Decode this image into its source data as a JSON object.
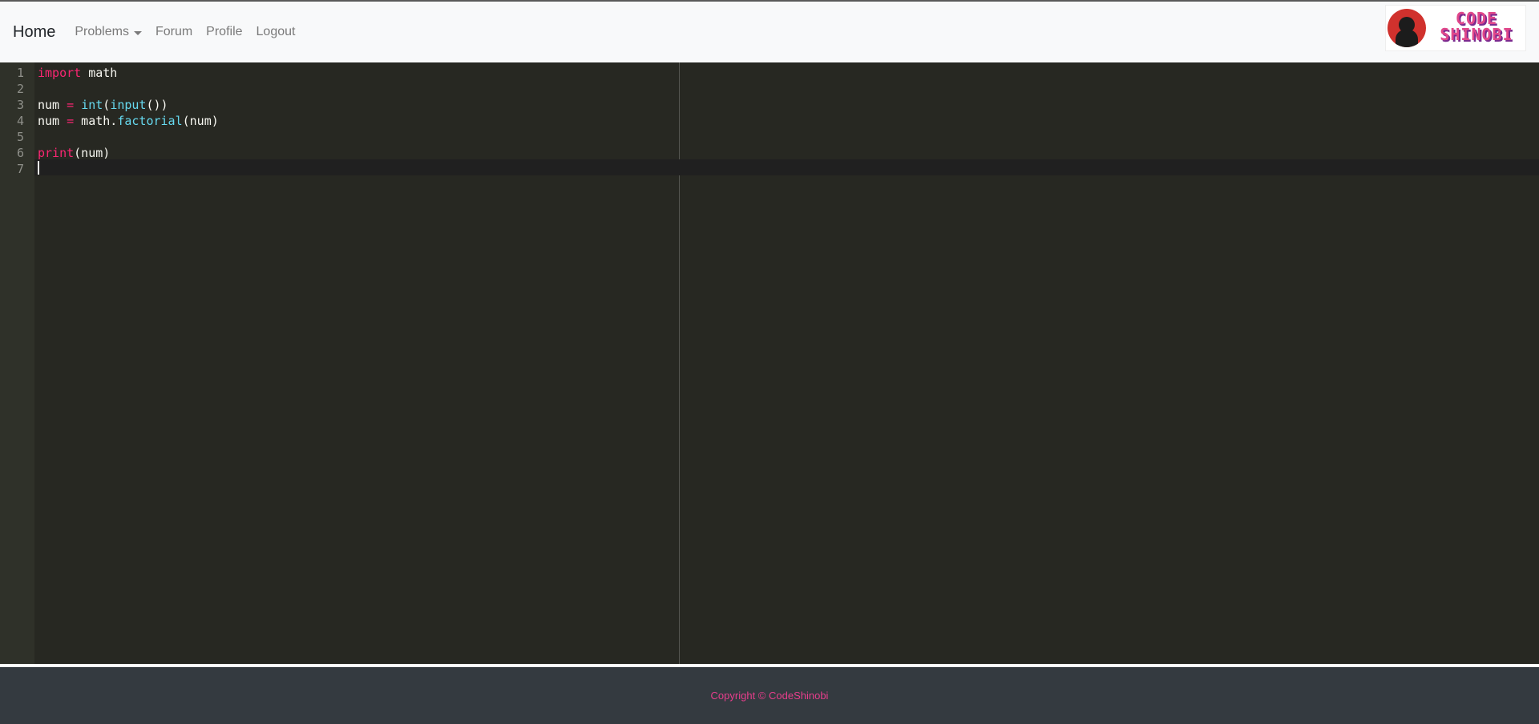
{
  "navbar": {
    "brand": "Home",
    "links": [
      {
        "label": "Problems",
        "has_dropdown": true
      },
      {
        "label": "Forum"
      },
      {
        "label": "Profile"
      },
      {
        "label": "Logout"
      }
    ],
    "logo": {
      "line1": "CODE",
      "line2": "SHINOBI"
    }
  },
  "editor": {
    "line_numbers": [
      "1",
      "2",
      "3",
      "4",
      "5",
      "6",
      "7"
    ],
    "lines": [
      [
        {
          "t": "import",
          "c": "kw"
        },
        {
          "t": " math",
          "c": ""
        }
      ],
      [],
      [
        {
          "t": "num ",
          "c": ""
        },
        {
          "t": "=",
          "c": "op"
        },
        {
          "t": " ",
          "c": ""
        },
        {
          "t": "int",
          "c": "fn"
        },
        {
          "t": "(",
          "c": ""
        },
        {
          "t": "input",
          "c": "fn"
        },
        {
          "t": "())",
          "c": ""
        }
      ],
      [
        {
          "t": "num ",
          "c": ""
        },
        {
          "t": "=",
          "c": "op"
        },
        {
          "t": " math.",
          "c": ""
        },
        {
          "t": "factorial",
          "c": "fn"
        },
        {
          "t": "(num)",
          "c": ""
        }
      ],
      [],
      [
        {
          "t": "print",
          "c": "kw"
        },
        {
          "t": "(num)",
          "c": ""
        }
      ],
      []
    ]
  },
  "footer": {
    "copyright": "Copyright © CodeShinobi"
  },
  "colors": {
    "editor_bg": "#272822",
    "keyword": "#f92672",
    "function": "#66d9ef",
    "footer_bg": "#343a40",
    "footer_text": "#e83e8c"
  }
}
